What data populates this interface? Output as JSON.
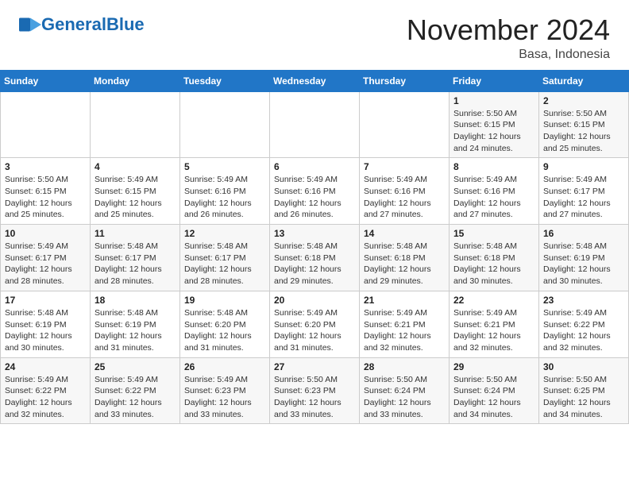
{
  "header": {
    "logo_line1": "General",
    "logo_line2": "Blue",
    "month": "November 2024",
    "location": "Basa, Indonesia"
  },
  "weekdays": [
    "Sunday",
    "Monday",
    "Tuesday",
    "Wednesday",
    "Thursday",
    "Friday",
    "Saturday"
  ],
  "weeks": [
    [
      {
        "day": "",
        "info": ""
      },
      {
        "day": "",
        "info": ""
      },
      {
        "day": "",
        "info": ""
      },
      {
        "day": "",
        "info": ""
      },
      {
        "day": "",
        "info": ""
      },
      {
        "day": "1",
        "info": "Sunrise: 5:50 AM\nSunset: 6:15 PM\nDaylight: 12 hours\nand 24 minutes."
      },
      {
        "day": "2",
        "info": "Sunrise: 5:50 AM\nSunset: 6:15 PM\nDaylight: 12 hours\nand 25 minutes."
      }
    ],
    [
      {
        "day": "3",
        "info": "Sunrise: 5:50 AM\nSunset: 6:15 PM\nDaylight: 12 hours\nand 25 minutes."
      },
      {
        "day": "4",
        "info": "Sunrise: 5:49 AM\nSunset: 6:15 PM\nDaylight: 12 hours\nand 25 minutes."
      },
      {
        "day": "5",
        "info": "Sunrise: 5:49 AM\nSunset: 6:16 PM\nDaylight: 12 hours\nand 26 minutes."
      },
      {
        "day": "6",
        "info": "Sunrise: 5:49 AM\nSunset: 6:16 PM\nDaylight: 12 hours\nand 26 minutes."
      },
      {
        "day": "7",
        "info": "Sunrise: 5:49 AM\nSunset: 6:16 PM\nDaylight: 12 hours\nand 27 minutes."
      },
      {
        "day": "8",
        "info": "Sunrise: 5:49 AM\nSunset: 6:16 PM\nDaylight: 12 hours\nand 27 minutes."
      },
      {
        "day": "9",
        "info": "Sunrise: 5:49 AM\nSunset: 6:17 PM\nDaylight: 12 hours\nand 27 minutes."
      }
    ],
    [
      {
        "day": "10",
        "info": "Sunrise: 5:49 AM\nSunset: 6:17 PM\nDaylight: 12 hours\nand 28 minutes."
      },
      {
        "day": "11",
        "info": "Sunrise: 5:48 AM\nSunset: 6:17 PM\nDaylight: 12 hours\nand 28 minutes."
      },
      {
        "day": "12",
        "info": "Sunrise: 5:48 AM\nSunset: 6:17 PM\nDaylight: 12 hours\nand 28 minutes."
      },
      {
        "day": "13",
        "info": "Sunrise: 5:48 AM\nSunset: 6:18 PM\nDaylight: 12 hours\nand 29 minutes."
      },
      {
        "day": "14",
        "info": "Sunrise: 5:48 AM\nSunset: 6:18 PM\nDaylight: 12 hours\nand 29 minutes."
      },
      {
        "day": "15",
        "info": "Sunrise: 5:48 AM\nSunset: 6:18 PM\nDaylight: 12 hours\nand 30 minutes."
      },
      {
        "day": "16",
        "info": "Sunrise: 5:48 AM\nSunset: 6:19 PM\nDaylight: 12 hours\nand 30 minutes."
      }
    ],
    [
      {
        "day": "17",
        "info": "Sunrise: 5:48 AM\nSunset: 6:19 PM\nDaylight: 12 hours\nand 30 minutes."
      },
      {
        "day": "18",
        "info": "Sunrise: 5:48 AM\nSunset: 6:19 PM\nDaylight: 12 hours\nand 31 minutes."
      },
      {
        "day": "19",
        "info": "Sunrise: 5:48 AM\nSunset: 6:20 PM\nDaylight: 12 hours\nand 31 minutes."
      },
      {
        "day": "20",
        "info": "Sunrise: 5:49 AM\nSunset: 6:20 PM\nDaylight: 12 hours\nand 31 minutes."
      },
      {
        "day": "21",
        "info": "Sunrise: 5:49 AM\nSunset: 6:21 PM\nDaylight: 12 hours\nand 32 minutes."
      },
      {
        "day": "22",
        "info": "Sunrise: 5:49 AM\nSunset: 6:21 PM\nDaylight: 12 hours\nand 32 minutes."
      },
      {
        "day": "23",
        "info": "Sunrise: 5:49 AM\nSunset: 6:22 PM\nDaylight: 12 hours\nand 32 minutes."
      }
    ],
    [
      {
        "day": "24",
        "info": "Sunrise: 5:49 AM\nSunset: 6:22 PM\nDaylight: 12 hours\nand 32 minutes."
      },
      {
        "day": "25",
        "info": "Sunrise: 5:49 AM\nSunset: 6:22 PM\nDaylight: 12 hours\nand 33 minutes."
      },
      {
        "day": "26",
        "info": "Sunrise: 5:49 AM\nSunset: 6:23 PM\nDaylight: 12 hours\nand 33 minutes."
      },
      {
        "day": "27",
        "info": "Sunrise: 5:50 AM\nSunset: 6:23 PM\nDaylight: 12 hours\nand 33 minutes."
      },
      {
        "day": "28",
        "info": "Sunrise: 5:50 AM\nSunset: 6:24 PM\nDaylight: 12 hours\nand 33 minutes."
      },
      {
        "day": "29",
        "info": "Sunrise: 5:50 AM\nSunset: 6:24 PM\nDaylight: 12 hours\nand 34 minutes."
      },
      {
        "day": "30",
        "info": "Sunrise: 5:50 AM\nSunset: 6:25 PM\nDaylight: 12 hours\nand 34 minutes."
      }
    ]
  ]
}
